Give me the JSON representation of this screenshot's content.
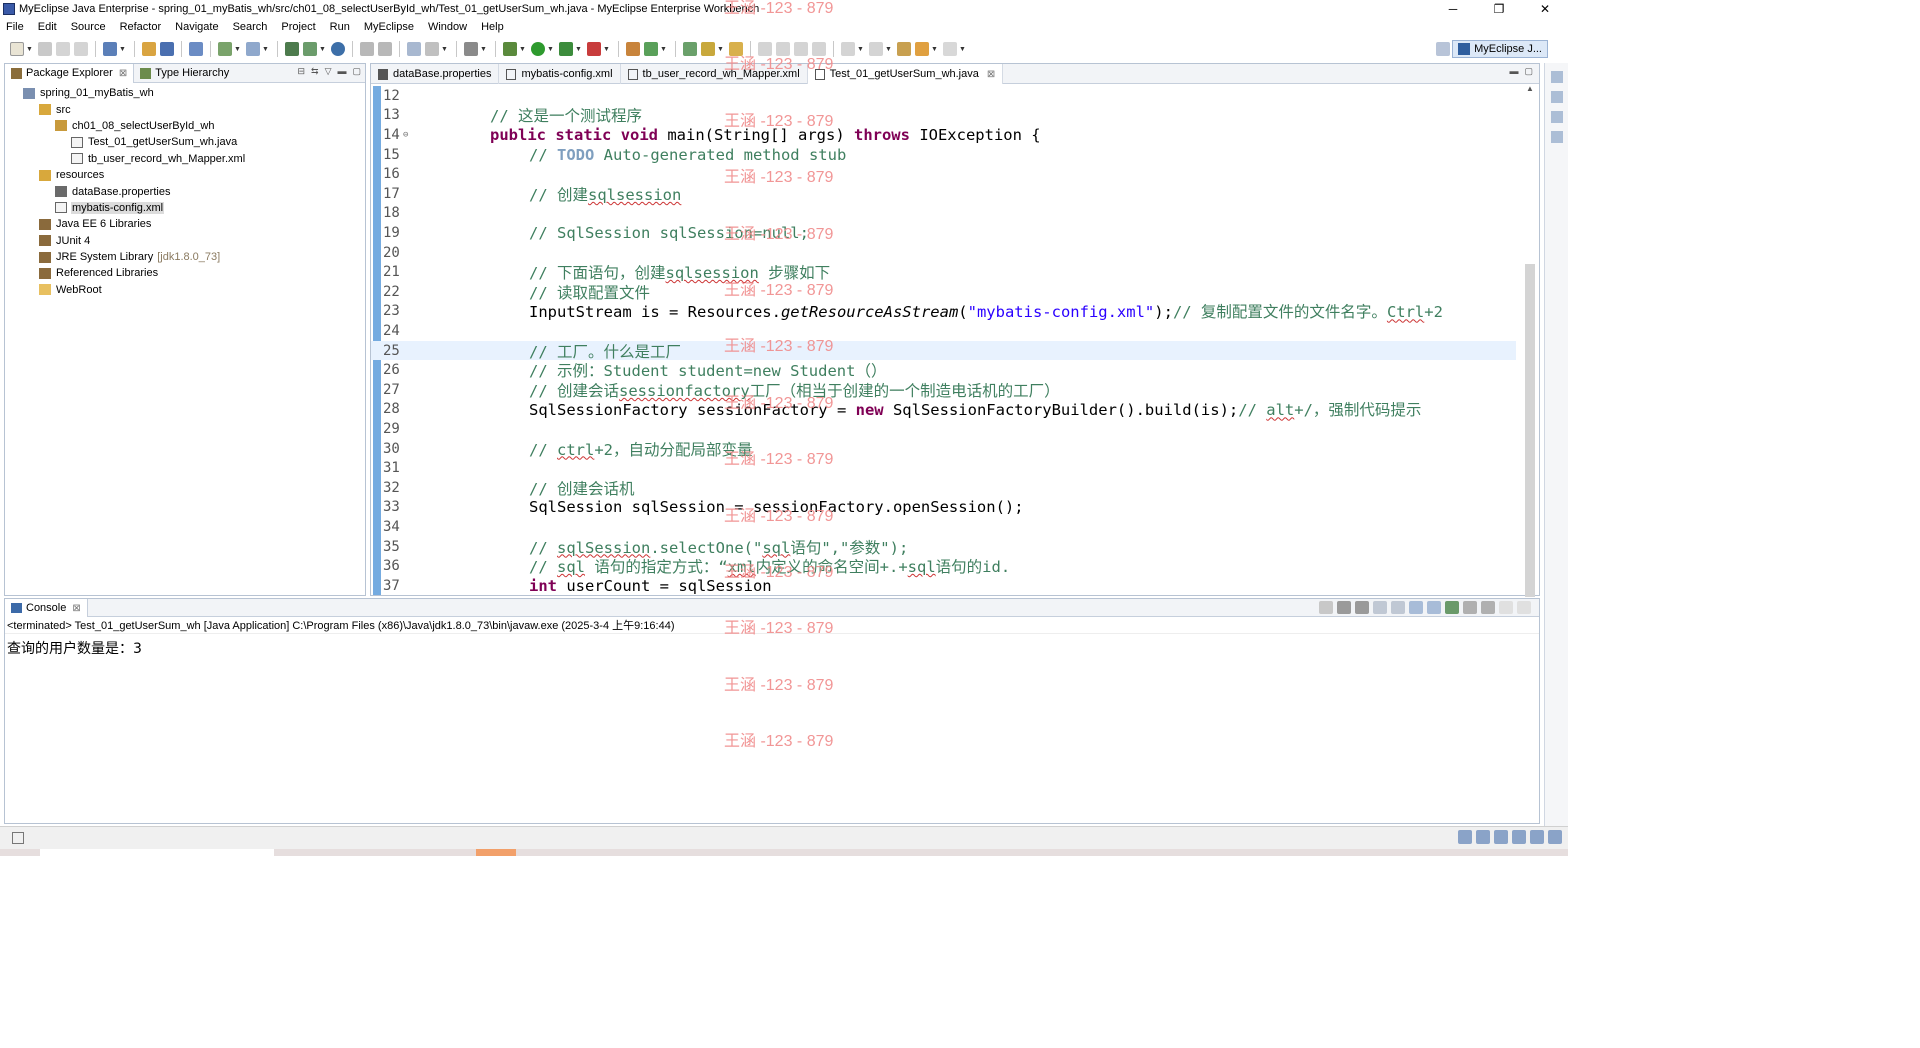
{
  "window": {
    "title": "MyEclipse Java Enterprise - spring_01_myBatis_wh/src/ch01_08_selectUserById_wh/Test_01_getUserSum_wh.java - MyEclipse Enterprise Workbench",
    "minimize": "─",
    "restore": "❐",
    "close": "✕"
  },
  "menu": [
    "File",
    "Edit",
    "Source",
    "Refactor",
    "Navigate",
    "Search",
    "Project",
    "Run",
    "MyEclipse",
    "Window",
    "Help"
  ],
  "perspective": {
    "label": "MyEclipse J..."
  },
  "package_explorer": {
    "tabs": [
      {
        "label": "Package Explorer",
        "close": "⊠"
      },
      {
        "label": "Type Hierarchy"
      }
    ],
    "tree": [
      {
        "label": "spring_01_myBatis_wh",
        "icon": "project-icon",
        "depth": 1
      },
      {
        "label": "src",
        "icon": "source-folder-icon",
        "depth": 2
      },
      {
        "label": "ch01_08_selectUserById_wh",
        "icon": "package-icon",
        "depth": 3
      },
      {
        "label": "Test_01_getUserSum_wh.java",
        "icon": "java-file-icon",
        "depth": 4
      },
      {
        "label": "tb_user_record_wh_Mapper.xml",
        "icon": "xml-file-icon",
        "depth": 4
      },
      {
        "label": "resources",
        "icon": "source-folder-icon",
        "depth": 2
      },
      {
        "label": "dataBase.properties",
        "icon": "properties-file-icon",
        "depth": 3
      },
      {
        "label": "mybatis-config.xml",
        "icon": "xml-file-icon",
        "depth": 3,
        "selected": true
      },
      {
        "label": "Java EE 6 Libraries",
        "icon": "library-icon",
        "depth": 2
      },
      {
        "label": "JUnit 4",
        "icon": "library-icon",
        "depth": 2
      },
      {
        "label": "JRE System Library",
        "suffix": "[jdk1.8.0_73]",
        "icon": "library-icon",
        "depth": 2
      },
      {
        "label": "Referenced Libraries",
        "icon": "library-icon",
        "depth": 2
      },
      {
        "label": "WebRoot",
        "icon": "folder-icon",
        "depth": 2
      }
    ]
  },
  "editor": {
    "tabs": [
      {
        "label": "dataBase.properties",
        "icon": "properties-file-icon"
      },
      {
        "label": "mybatis-config.xml",
        "icon": "xml-file-icon"
      },
      {
        "label": "tb_user_record_wh_Mapper.xml",
        "icon": "xml-file-icon"
      },
      {
        "label": "Test_01_getUserSum_wh.java",
        "icon": "java-file-icon",
        "active": true,
        "close": "⊠"
      }
    ],
    "highlighted_line": 25,
    "lines": [
      {
        "n": "12",
        "html": ""
      },
      {
        "n": "13",
        "html": "<span class=\"cm\">// 这是一个测试程序</span>",
        "indent": 1
      },
      {
        "n": "14",
        "html": "<span class=\"kw\">public</span> <span class=\"kw\">static</span> <span class=\"kw\">void</span> main(String[] args) <span class=\"kw\">throws</span> IOException {",
        "indent": 1,
        "fold": "⊖"
      },
      {
        "n": "15",
        "html": "<span class=\"cm\">// </span><span class=\"todo\">TODO</span><span class=\"cm\"> Auto-generated method stub</span>",
        "indent": 2
      },
      {
        "n": "16",
        "html": ""
      },
      {
        "n": "17",
        "html": "<span class=\"cm\">// 创建<span class=\"sq\">sqlsession</span></span>",
        "indent": 2
      },
      {
        "n": "18",
        "html": ""
      },
      {
        "n": "19",
        "html": "<span class=\"cm\">// SqlSession sqlSession=null;</span>",
        "indent": 2
      },
      {
        "n": "20",
        "html": ""
      },
      {
        "n": "21",
        "html": "<span class=\"cm\">// 下面语句，创建<span class=\"sq\">sqlsession</span> 步骤如下</span>",
        "indent": 2
      },
      {
        "n": "22",
        "html": "<span class=\"cm\">// 读取配置文件</span>",
        "indent": 2
      },
      {
        "n": "23",
        "html": "InputStream is = Resources.<span class=\"it\">getResourceAsStream</span>(<span class=\"str\">\"mybatis-config.xml\"</span>);<span class=\"cm\">// 复制配置文件的文件名字。<span class=\"sq\">Ctrl</span>+2</span>",
        "indent": 2
      },
      {
        "n": "24",
        "html": ""
      },
      {
        "n": "25",
        "html": "<span class=\"cm\">// 工厂。什么是工厂</span>",
        "indent": 2
      },
      {
        "n": "26",
        "html": "<span class=\"cm\">// 示例：Student student=new Student（）</span>",
        "indent": 2
      },
      {
        "n": "27",
        "html": "<span class=\"cm\">// 创建会话<span class=\"sq\">sessionfactory</span>工厂（相当于创建的一个制造电话机的工厂）</span>",
        "indent": 2
      },
      {
        "n": "28",
        "html": "SqlSessionFactory sessionFactory = <span class=\"kw\">new</span> SqlSessionFactoryBuilder().build(is);<span class=\"cm\">// <span class=\"sq\">alt</span>+/，强制代码提示</span>",
        "indent": 2
      },
      {
        "n": "29",
        "html": ""
      },
      {
        "n": "30",
        "html": "<span class=\"cm\">// <span class=\"sq\">ctrl</span>+2，自动分配局部变量</span>",
        "indent": 2
      },
      {
        "n": "31",
        "html": ""
      },
      {
        "n": "32",
        "html": "<span class=\"cm\">// 创建会话机</span>",
        "indent": 2
      },
      {
        "n": "33",
        "html": "SqlSession sqlSession = sessionFactory.openSession();",
        "indent": 2
      },
      {
        "n": "34",
        "html": ""
      },
      {
        "n": "35",
        "html": "<span class=\"cm\">// <span class=\"sq\">sqlSession</span>.selectOne(\"<span class=\"sq\">sql</span>语句\",\"参数\");</span>",
        "indent": 2
      },
      {
        "n": "36",
        "html": "<span class=\"cm\">// <span class=\"sq\">sql</span> 语句的指定方式：“<span class=\"sq\">xml</span>内定义的命名空间+.+<span class=\"sq\">sql</span>语句的id.</span>",
        "indent": 2
      },
      {
        "n": "37",
        "html": "<span class=\"kw\">int</span> userCount = sqlSession",
        "indent": 2
      }
    ]
  },
  "console": {
    "tab_label": "Console",
    "close": "⊠",
    "info": "<terminated> Test_01_getUserSum_wh [Java Application] C:\\Program Files (x86)\\Java\\jdk1.8.0_73\\bin\\javaw.exe (2025-3-4 上午9:16:44)",
    "output": "查询的用户数量是：3"
  },
  "watermark": "王涵 -123 - 879"
}
